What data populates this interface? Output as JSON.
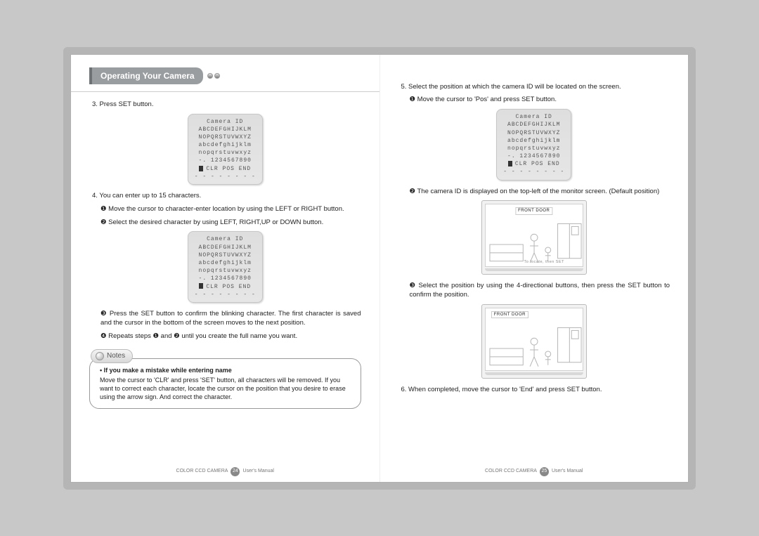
{
  "header": {
    "section_title": "Operating Your Camera"
  },
  "left": {
    "step3": "3. Press SET button.",
    "step4": "4. You can enter up to 15 characters.",
    "step4_a": "❶ Move the cursor to character-enter location by using the LEFT or RIGHT button.",
    "step4_b": "❷ Select the desired character by using LEFT, RIGHT,UP or DOWN button.",
    "step4_c": "❸ Press the SET button to confirm the blinking character. The first character is saved and the cursor in the bottom of the screen moves to the next position.",
    "step4_d": "❹ Repeats steps ❶ and ❷ until you create the full name you want."
  },
  "osd": {
    "title": "Camera ID",
    "row1": "ABCDEFGHIJKLM",
    "row2": "NOPQRSTUVWXYZ",
    "row3": "abcdefghijklm",
    "row4": "nopqrstuvwxyz",
    "row5": "-. 1234567890",
    "row6": "CLR POS END"
  },
  "notes": {
    "label": "Notes",
    "lead": "• If you make a mistake while entering name",
    "body": "Move the cursor to 'CLR' and press 'SET' button, all characters will be removed. If you want to correct each character, locate the cursor on the position that you desire to erase using the arrow sign. And correct the character."
  },
  "right": {
    "step5": "5. Select the position at which the camera ID will be located on the screen.",
    "step5_a": "❶ Move the cursor to 'Pos' and press SET button.",
    "step5_b": "❷ The camera ID is displayed on the top-left of the monitor screen. (Default position)",
    "step5_c": "❸ Select the position by using the 4-directional buttons, then press the SET button to confirm the position.",
    "step6": "6. When completed, move the cursor to 'End' and press SET button."
  },
  "monitor": {
    "label": "FRONT DOOR",
    "caption": "To locate, then SET"
  },
  "footer": {
    "product": "COLOR CCD CAMERA",
    "page_left": "24",
    "page_right": "25",
    "subtitle": "User's Manual"
  }
}
